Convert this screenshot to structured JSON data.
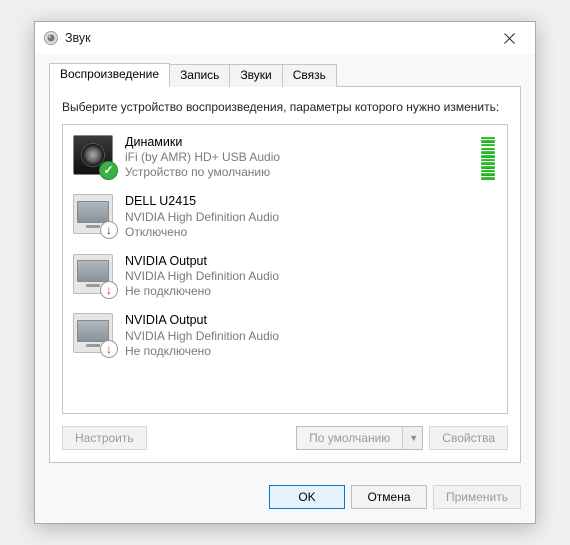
{
  "window": {
    "title": "Звук",
    "close_icon": "close-icon"
  },
  "tabs": [
    {
      "label": "Воспроизведение",
      "active": true
    },
    {
      "label": "Запись",
      "active": false
    },
    {
      "label": "Звуки",
      "active": false
    },
    {
      "label": "Связь",
      "active": false
    }
  ],
  "instruction": "Выберите устройство воспроизведения, параметры которого нужно изменить:",
  "devices": [
    {
      "name": "Динамики",
      "driver": "iFi (by AMR) HD+ USB Audio",
      "status": "Устройство по умолчанию",
      "icon": "speaker",
      "badge": "default-green",
      "level_bars": 12
    },
    {
      "name": "DELL U2415",
      "driver": "NVIDIA High Definition Audio",
      "status": "Отключено",
      "icon": "monitor",
      "badge": "disabled-down"
    },
    {
      "name": "NVIDIA Output",
      "driver": "NVIDIA High Definition Audio",
      "status": "Не подключено",
      "icon": "monitor",
      "badge": "unplugged-red"
    },
    {
      "name": "NVIDIA Output",
      "driver": "NVIDIA High Definition Audio",
      "status": "Не подключено",
      "icon": "monitor",
      "badge": "unplugged-red"
    }
  ],
  "panel_buttons": {
    "configure": "Настроить",
    "set_default": "По умолчанию",
    "properties": "Свойства"
  },
  "dialog_buttons": {
    "ok": "OK",
    "cancel": "Отмена",
    "apply": "Применить"
  }
}
